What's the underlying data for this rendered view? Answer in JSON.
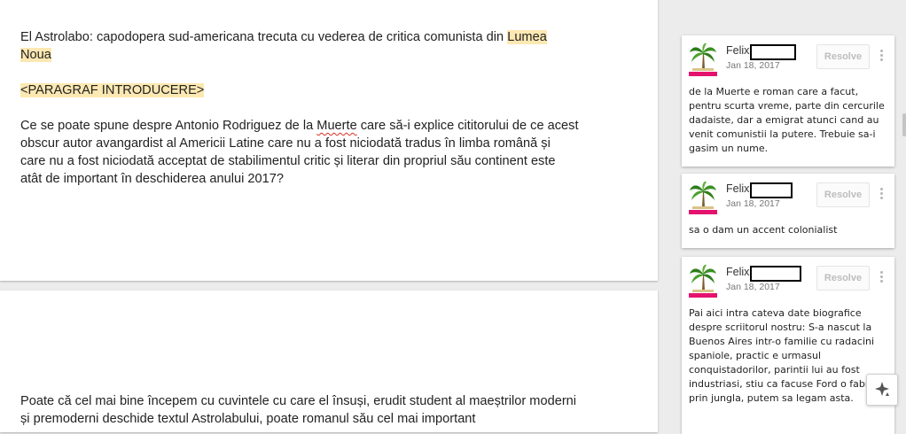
{
  "document": {
    "page1": {
      "title_text": "El Astrolabo: capodopera sud-americana trecuta cu vederea de critica comunista din ",
      "title_highlight": "Lumea Noua",
      "placeholder": "<PARAGRAF INTRODUCERE>",
      "para_before": "Ce se poate spune despre Antonio Rodriguez de la ",
      "para_spell": "Muerte",
      "para_after": " care să-i explice cititorului de ce acest obscur autor avangardist al Americii Latine care nu a fost niciodată tradus în limba română și care nu a fost niciodată acceptat de stabilimentul critic și literar din propriul său continent este atât de important în deschiderea anului 2017?"
    },
    "page2": {
      "para": "Poate că cel mai bine începem cu cuvintele cu care el însuși, erudit student al maeștrilor moderni și premoderni deschide textul Astrolabului, poate romanul său cel mai important"
    }
  },
  "comments": [
    {
      "author": "Felix",
      "date": "Jan 18, 2017",
      "resolve": "Resolve",
      "text": "de la Muerte e roman care a facut, pentru scurta vreme, parte din cercurile dadaiste, dar a emigrat atunci cand au venit comunistii la putere. Trebuie sa-i gasim un nume."
    },
    {
      "author": "Felix",
      "date": "Jan 18, 2017",
      "resolve": "Resolve",
      "text": "sa o dam un accent colonialist"
    },
    {
      "author": "Felix",
      "date": "Jan 18, 2017",
      "resolve": "Resolve",
      "text": "Pai aici intra cateva date biografice despre scriitorul nostru: S-a nascut la Buenos Aires intr-o familie cu radacini spaniole, practic e urmasul conquistadorilor, parintii lui au fost industriasi, stiu ca facuse Ford o fabrica prin jungla, putem sa legam asta."
    }
  ],
  "icons": {
    "avatar": "palm-tree-avatar",
    "more": "more-vertical-icon",
    "explore": "explore-icon"
  },
  "colors": {
    "highlight": "#fce8b2",
    "avatar_bar": "#e5126d",
    "spellcheck": "#d93025"
  }
}
